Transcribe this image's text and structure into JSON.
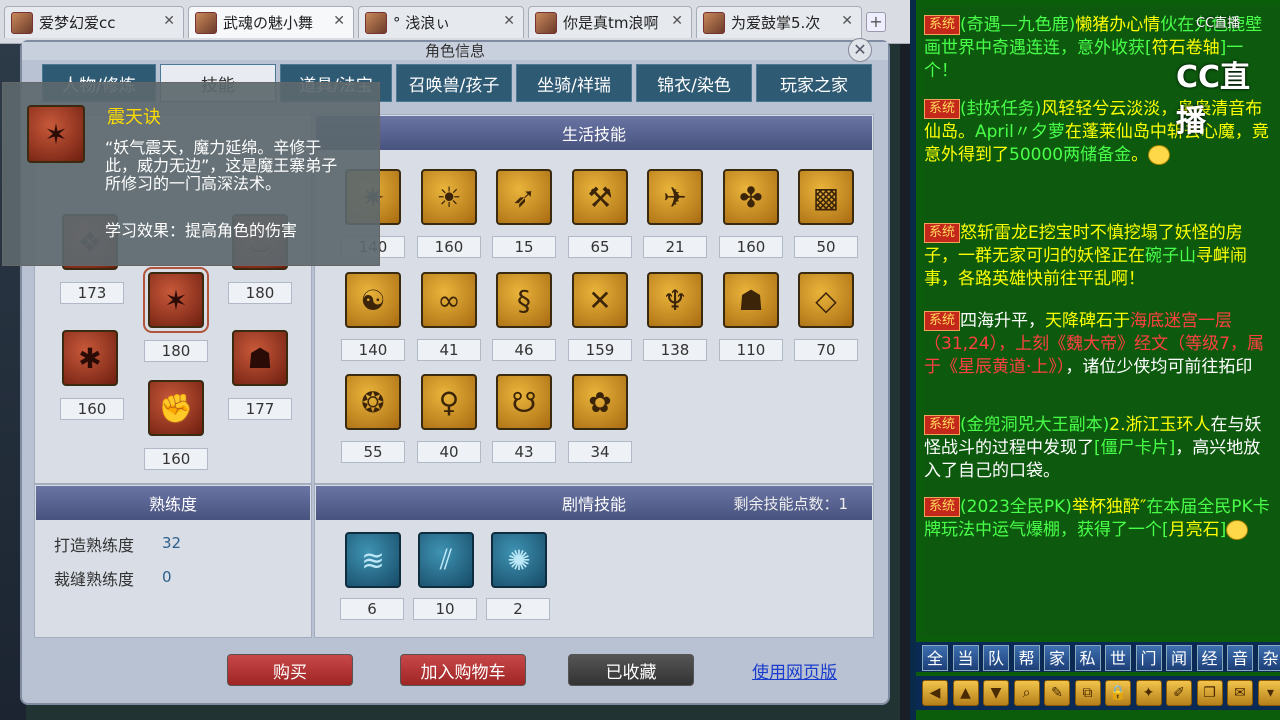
{
  "browser_tabs": [
    {
      "title": "爱梦幻爱cc"
    },
    {
      "title": "武魂の魅小舞"
    },
    {
      "title": "° 浅浪ぃ"
    },
    {
      "title": "你是真tm浪啊"
    },
    {
      "title": "为爱鼓掌5.次"
    }
  ],
  "window": {
    "title": "角色信息"
  },
  "top_tabs": [
    "人物/修炼",
    "技能",
    "道具/法宝",
    "召唤兽/孩子",
    "坐骑/祥瑞",
    "锦衣/染色",
    "玩家之家"
  ],
  "tooltip": {
    "name": "震天诀",
    "description": "“妖气震天，魔力延绵。辛修于此，威力无边”，这是魔王寨弟子所修习的一门高深法术。",
    "effect": "学习效果：提高角色的伤害"
  },
  "school_skills": [
    {
      "icon": "book-icon",
      "level": "180"
    },
    {
      "icon": "shield-icon",
      "level": "173"
    },
    {
      "icon": "fire-icon",
      "level": "180"
    },
    {
      "icon": "claw-icon",
      "level": "180"
    },
    {
      "icon": "skull-icon",
      "level": "180"
    },
    {
      "icon": "spider-icon",
      "level": "160"
    },
    {
      "icon": "demon-icon",
      "level": "177"
    },
    {
      "icon": "fist-icon",
      "level": "160"
    }
  ],
  "life_skills": {
    "title": "生活技能",
    "levels": [
      "140",
      "160",
      "15",
      "65",
      "21",
      "160",
      "50",
      "140",
      "41",
      "46",
      "159",
      "138",
      "110",
      "70",
      "55",
      "40",
      "43",
      "34"
    ]
  },
  "proficiency": {
    "title": "熟练度",
    "items": [
      {
        "label": "打造熟练度",
        "value": "32"
      },
      {
        "label": "裁缝熟练度",
        "value": "0"
      }
    ]
  },
  "story_skills": {
    "title": "剧情技能",
    "remaining_label": "剩余技能点数：",
    "remaining_value": "1",
    "levels": [
      "6",
      "10",
      "2"
    ]
  },
  "buttons": {
    "buy": "购买",
    "add_cart": "加入购物车",
    "favorited": "已收藏",
    "web_version": "使用网页版"
  },
  "chat": {
    "logo": "CC直播",
    "logo_small": "CC直播",
    "badge": "系统",
    "messages": [
      {
        "parts": [
          {
            "c": "g",
            "t": "(奇遇—九色鹿)"
          },
          {
            "c": "y",
            "t": "懒猪办心情"
          },
          {
            "c": "g",
            "t": "伙在九色鹿壁画世界中奇遇连连，意外收获["
          },
          {
            "c": "y",
            "t": "符石卷轴"
          },
          {
            "c": "g",
            "t": "]一个！"
          }
        ]
      },
      {
        "parts": [
          {
            "c": "g",
            "t": "(封妖任务)"
          },
          {
            "c": "y",
            "t": "风轻轻兮云淡淡，袅袅清音布仙岛。"
          },
          {
            "c": "g",
            "t": "April〃夕萝"
          },
          {
            "c": "y",
            "t": "在蓬莱仙岛中斩去心魔，竟意外得到了"
          },
          {
            "c": "g",
            "t": "50000两储备金"
          },
          {
            "c": "y",
            "t": "。"
          }
        ]
      },
      {
        "parts": [
          {
            "c": "y",
            "t": "怒斩雷龙E挖宝时不慎挖塌了妖怪的房子，一群无家可归的妖怪正在"
          },
          {
            "c": "g",
            "t": "碗子山"
          },
          {
            "c": "y",
            "t": "寻衅闹事，各路英雄快前往平乱啊！"
          }
        ]
      },
      {
        "parts": [
          {
            "c": "w",
            "t": "四海升平，"
          },
          {
            "c": "y",
            "t": "天降碑石于"
          },
          {
            "c": "r",
            "t": "海底迷宫一层（31,24），上刻《魏大帝》经文（等级7，属于《星辰黄道·上》）"
          },
          {
            "c": "w",
            "t": "，诸位少侠均可前往拓印"
          }
        ]
      },
      {
        "parts": [
          {
            "c": "g",
            "t": "(金兜洞兕大王副本)"
          },
          {
            "c": "y",
            "t": "2.浙江玉环人"
          },
          {
            "c": "w",
            "t": "在与妖怪战斗的过程中发现了"
          },
          {
            "c": "g",
            "t": "[僵尸卡片]"
          },
          {
            "c": "w",
            "t": "，高兴地放入了自己的口袋。"
          }
        ]
      },
      {
        "parts": [
          {
            "c": "g",
            "t": "(2023全民PK)"
          },
          {
            "c": "y",
            "t": "举杯独醉″"
          },
          {
            "c": "g",
            "t": "在本届全民PK卡牌玩法中运气爆棚，获得了一个["
          },
          {
            "c": "y",
            "t": "月亮石"
          },
          {
            "c": "g",
            "t": "]"
          }
        ]
      }
    ],
    "channels": [
      "全",
      "当",
      "队",
      "帮",
      "家",
      "私",
      "世",
      "门",
      "闻",
      "经",
      "音",
      "杂"
    ],
    "tools": [
      "left-arrow-icon",
      "up-arrow-icon",
      "down-arrow-icon",
      "search-icon",
      "note-icon",
      "lock-icon",
      "bag-icon",
      "paint-icon",
      "copy-icon",
      "chat-icon",
      "list-icon",
      "down-icon"
    ]
  }
}
